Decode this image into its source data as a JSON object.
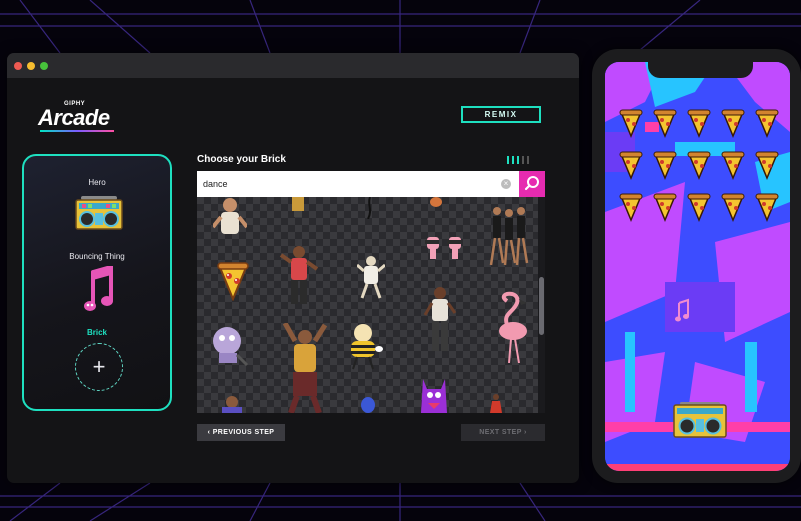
{
  "window": {
    "logo_giphy": "GIPHY",
    "logo_arcade": "Arcade",
    "remix_label": "REMIX"
  },
  "panel": {
    "slots": [
      {
        "label": "Hero",
        "art": "boombox-icon"
      },
      {
        "label": "Bouncing Thing",
        "art": "music-note-icon"
      },
      {
        "label": "Brick",
        "art": "add-icon",
        "active": true
      }
    ],
    "add_symbol": "+"
  },
  "search": {
    "title": "Choose your Brick",
    "value": "dance",
    "clear_symbol": "×",
    "step_count": 5,
    "current_step": 3
  },
  "results": [
    "dancing-man-gif",
    "dancer-gif",
    "dancer-gif",
    "dancer-gif",
    "dancing-group-gif",
    "pizza-slice-gif",
    "dancing-man-gif",
    "dancing-figure-gif",
    "feet-gif",
    "alien-dancer-gif",
    "dancing-man-gif",
    "cartoon-bee-gif",
    "dancing-woman-gif",
    "flamingo-gif",
    "dancing-man-gif",
    "purple-monster-gif",
    "dancer-gif"
  ],
  "nav": {
    "prev_label": "‹ PREVIOUS STEP",
    "next_label": "NEXT STEP ›"
  },
  "colors": {
    "accent": "#1ee0c0",
    "search_button": "#e62bb0",
    "background": "#05030c",
    "window": "#141416"
  },
  "phone": {
    "bricks": "pizza-slice-icon",
    "bouncing_thing": "music-note-icon",
    "hero": "boombox-icon"
  }
}
